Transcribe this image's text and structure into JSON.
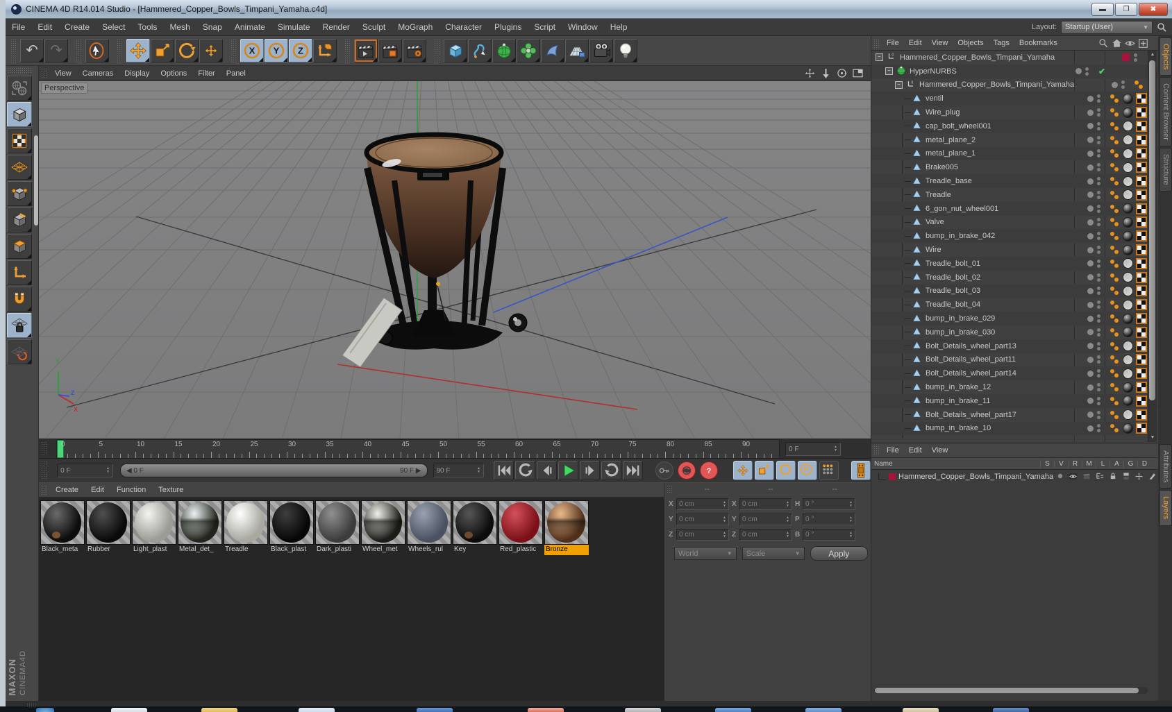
{
  "window": {
    "title": "CINEMA 4D R14.014 Studio - [Hammered_Copper_Bowls_Timpani_Yamaha.c4d]",
    "controls": {
      "minimize": "_",
      "restore": "r",
      "close": "X"
    }
  },
  "menu_bar": {
    "items": [
      "File",
      "Edit",
      "Create",
      "Select",
      "Tools",
      "Mesh",
      "Snap",
      "Animate",
      "Simulate",
      "Render",
      "Sculpt",
      "MoGraph",
      "Character",
      "Plugins",
      "Script",
      "Window",
      "Help"
    ],
    "layout_label": "Layout:",
    "layout_value": "Startup (User)"
  },
  "main_toolbar": {
    "groups": [
      [
        "undo-icon",
        "redo-icon"
      ],
      [
        "live-selection-icon"
      ],
      [
        "move-icon:active",
        "scale-icon",
        "rotate-icon",
        "last-tool-icon"
      ],
      [
        "axis-x-icon:active",
        "axis-y-icon:active",
        "axis-z-icon:active",
        "coordinate-system-icon"
      ],
      [
        "render-view-icon:ring",
        "render-picture-viewer-icon",
        "render-settings-icon"
      ],
      [
        "primitive-cube-icon",
        "spline-icon",
        "hypernurbs-icon",
        "mograph-icon",
        "deformer-icon",
        "floor-icon",
        "camera-icon",
        "light-icon"
      ]
    ],
    "axis_letters": {
      "axis-x-icon": "X",
      "axis-y-icon": "Y",
      "axis-z-icon": "Z"
    }
  },
  "left_toolbar": {
    "icons": [
      "make-editable-icon",
      "model-mode-icon:active",
      "texture-mode-icon",
      "workplane-mode-icon",
      "points-mode-icon",
      "edges-mode-icon",
      "polygons-mode-icon",
      "axis-mode-icon",
      "snap-icon",
      "lock-workplane-icon:active",
      "rotate-workplane-icon"
    ]
  },
  "branding": {
    "maxon": "MAXON",
    "cinema": "CINEMA4D"
  },
  "viewport": {
    "menus": [
      "View",
      "Cameras",
      "Display",
      "Options",
      "Filter",
      "Panel"
    ],
    "view_label": "Perspective",
    "nav_icons": [
      "pan-view-icon",
      "zoom-view-icon",
      "rotate-view-icon",
      "toggle-layout-icon"
    ],
    "axis_labels": {
      "x": "X",
      "y": "Y",
      "z": "Z"
    },
    "axis_colors": {
      "x": "#c03030",
      "y": "#2f9e3f",
      "z": "#3a55c8"
    }
  },
  "timeline": {
    "tick_step": 5,
    "tick_labels": [
      "0",
      "5",
      "10",
      "15",
      "20",
      "25",
      "30",
      "35",
      "40",
      "45",
      "50",
      "55",
      "60",
      "65",
      "70",
      "75",
      "80",
      "85",
      "90"
    ],
    "ruler_end_value": "0 F",
    "current_frame": "0 F",
    "range_start": "0 F",
    "range_end": "90 F",
    "end_frame": "90 F",
    "transport_icons": [
      "goto-start-icon",
      "play-backward-icon",
      "previous-frame-icon",
      "play-icon",
      "next-frame-icon",
      "play-cycle-icon",
      "goto-end-icon"
    ],
    "record_icons": [
      "record-key-icon",
      "autokey-icon",
      "keyframe-question-icon"
    ],
    "keying_icons": [
      "key-position-icon:active",
      "key-scale-icon:active",
      "key-rotation-icon:active",
      "key-parameter-icon:active",
      "key-pla-icon"
    ],
    "picture_viewer_icon": "picture-viewer-icon"
  },
  "materials": {
    "menus": [
      "Create",
      "Edit",
      "Function",
      "Texture"
    ],
    "items": [
      {
        "name": "Black_meta",
        "c1": "#6a6a6a",
        "c2": "#0d0d0d",
        "spot": "#7a5230"
      },
      {
        "name": "Rubber",
        "c1": "#505050",
        "c2": "#0a0a0a"
      },
      {
        "name": "Light_plast",
        "c1": "#f4f4f0",
        "c2": "#9c9c96"
      },
      {
        "name": "Metal_det_",
        "c1": "#eaf2f2",
        "c2": "#23251c",
        "chrome": true
      },
      {
        "name": "Treadle",
        "c1": "#ffffff",
        "c2": "#a8a8a0"
      },
      {
        "name": "Black_plast",
        "c1": "#3e3e3e",
        "c2": "#070707"
      },
      {
        "name": "Dark_plasti",
        "c1": "#909090",
        "c2": "#3c3c3c"
      },
      {
        "name": "Wheel_met",
        "c1": "#f0f0ea",
        "c2": "#1c1c18",
        "chrome": true
      },
      {
        "name": "Wheels_rul",
        "c1": "#9aa2b2",
        "c2": "#4a5160"
      },
      {
        "name": "Key",
        "c1": "#565656",
        "c2": "#0c0c0c",
        "spot": "#6e4a2a"
      },
      {
        "name": "Red_plastic",
        "c1": "#d4505a",
        "c2": "#7c1018"
      },
      {
        "name": "Bronze",
        "c1": "#eab88a",
        "c2": "#50301c",
        "chrome": true,
        "selected": true
      }
    ]
  },
  "coordinates": {
    "headers": [
      "--",
      "--",
      "--"
    ],
    "position": {
      "labels": [
        "X",
        "Y",
        "Z"
      ],
      "values": [
        "0 cm",
        "0 cm",
        "0 cm"
      ]
    },
    "scale": {
      "labels": [
        "X",
        "Y",
        "Z"
      ],
      "values": [
        "0 cm",
        "0 cm",
        "0 cm"
      ]
    },
    "rotation": {
      "labels": [
        "H",
        "P",
        "B"
      ],
      "values": [
        "0 °",
        "0 °",
        "0 °"
      ]
    },
    "mode1": "World",
    "mode2": "Scale",
    "apply_label": "Apply"
  },
  "object_manager": {
    "menus": [
      "File",
      "Edit",
      "View",
      "Objects",
      "Tags",
      "Bookmarks"
    ],
    "header_icons": [
      "search-icon",
      "home-icon",
      "eye-icon",
      "add-view-icon"
    ],
    "side_tabs": [
      {
        "label": "Objects",
        "active": true
      },
      {
        "label": "Content Browser",
        "active": false
      },
      {
        "label": "Structure",
        "active": false
      }
    ],
    "tree": [
      {
        "label": "Hammered_Copper_Bowls_Timpani_Yamaha",
        "depth": 0,
        "icon": "null-object-icon",
        "expander": true,
        "chip": "#a8133c"
      },
      {
        "label": "HyperNURBS",
        "depth": 1,
        "icon": "hypernurbs-small-icon",
        "expander": true,
        "dot": true,
        "check": true
      },
      {
        "label": "Hammered_Copper_Bowls_Timpani_Yamaha",
        "depth": 2,
        "icon": "null-object-icon",
        "expander": true,
        "dot": true,
        "phong": true
      },
      {
        "label": "ventil",
        "depth": 3,
        "icon": "polygon-icon",
        "dot": true,
        "phong": true,
        "mat": "#151515",
        "uvw": true
      },
      {
        "label": "Wire_plug",
        "depth": 3,
        "icon": "polygon-icon",
        "dot": true,
        "phong": true,
        "mat": "#151515",
        "uvw": true
      },
      {
        "label": "cap_bolt_wheel001",
        "depth": 3,
        "icon": "polygon-icon",
        "dot": true,
        "phong": true,
        "mat": "#d6d6d2",
        "uvw": true
      },
      {
        "label": "metal_plane_2",
        "depth": 3,
        "icon": "polygon-icon",
        "dot": true,
        "phong": true,
        "mat": "#d6d6d2",
        "uvw": true
      },
      {
        "label": "metal_plane_1",
        "depth": 3,
        "icon": "polygon-icon",
        "dot": true,
        "phong": true,
        "mat": "#d6d6d2",
        "uvw": true
      },
      {
        "label": "Brake005",
        "depth": 3,
        "icon": "polygon-icon",
        "dot": true,
        "phong": true,
        "mat": "#d6d6d2",
        "uvw": true
      },
      {
        "label": "Treadle_base",
        "depth": 3,
        "icon": "polygon-icon",
        "dot": true,
        "phong": true,
        "mat": "#d6d6d2",
        "uvw": true
      },
      {
        "label": "Treadle",
        "depth": 3,
        "icon": "polygon-icon",
        "dot": true,
        "phong": true,
        "mat": "#d6d6d2",
        "uvw": true
      },
      {
        "label": "6_gon_nut_wheel001",
        "depth": 3,
        "icon": "polygon-icon",
        "dot": true,
        "phong": true,
        "mat": "#151515",
        "uvw": true
      },
      {
        "label": "Valve",
        "depth": 3,
        "icon": "polygon-icon",
        "dot": true,
        "phong": true,
        "mat": "#151515",
        "uvw": true
      },
      {
        "label": "bump_in_brake_042",
        "depth": 3,
        "icon": "polygon-icon",
        "dot": true,
        "phong": true,
        "mat": "#151515",
        "uvw": true
      },
      {
        "label": "Wire",
        "depth": 3,
        "icon": "polygon-icon",
        "dot": true,
        "phong": true,
        "mat": "#151515",
        "uvw": true
      },
      {
        "label": "Treadle_bolt_01",
        "depth": 3,
        "icon": "polygon-icon",
        "dot": true,
        "phong": true,
        "mat": "#d6d6d2",
        "uvw": true
      },
      {
        "label": "Treadle_bolt_02",
        "depth": 3,
        "icon": "polygon-icon",
        "dot": true,
        "phong": true,
        "mat": "#d6d6d2",
        "uvw": true
      },
      {
        "label": "Treadle_bolt_03",
        "depth": 3,
        "icon": "polygon-icon",
        "dot": true,
        "phong": true,
        "mat": "#d6d6d2",
        "uvw": true
      },
      {
        "label": "Treadle_bolt_04",
        "depth": 3,
        "icon": "polygon-icon",
        "dot": true,
        "phong": true,
        "mat": "#d6d6d2",
        "uvw": true
      },
      {
        "label": "bump_in_brake_029",
        "depth": 3,
        "icon": "polygon-icon",
        "dot": true,
        "phong": true,
        "mat": "#151515",
        "uvw": true
      },
      {
        "label": "bump_in_brake_030",
        "depth": 3,
        "icon": "polygon-icon",
        "dot": true,
        "phong": true,
        "mat": "#151515",
        "uvw": true
      },
      {
        "label": "Bolt_Details_wheel_part13",
        "depth": 3,
        "icon": "polygon-icon",
        "dot": true,
        "phong": true,
        "mat": "#d6d6d2",
        "uvw": true
      },
      {
        "label": "Bolt_Details_wheel_part11",
        "depth": 3,
        "icon": "polygon-icon",
        "dot": true,
        "phong": true,
        "mat": "#d6d6d2",
        "uvw": true
      },
      {
        "label": "Bolt_Details_wheel_part14",
        "depth": 3,
        "icon": "polygon-icon",
        "dot": true,
        "phong": true,
        "mat": "#d6d6d2",
        "uvw": true
      },
      {
        "label": "bump_in_brake_12",
        "depth": 3,
        "icon": "polygon-icon",
        "dot": true,
        "phong": true,
        "mat": "#151515",
        "uvw": true
      },
      {
        "label": "bump_in_brake_11",
        "depth": 3,
        "icon": "polygon-icon",
        "dot": true,
        "phong": true,
        "mat": "#151515",
        "uvw": true
      },
      {
        "label": "Bolt_Details_wheel_part17",
        "depth": 3,
        "icon": "polygon-icon",
        "dot": true,
        "phong": true,
        "mat": "#d6d6d2",
        "uvw": true
      },
      {
        "label": "bump_in_brake_10",
        "depth": 3,
        "icon": "polygon-icon",
        "dot": true,
        "phong": true,
        "mat": "#151515",
        "uvw": true
      }
    ]
  },
  "layer_manager": {
    "menus": [
      "File",
      "Edit",
      "View"
    ],
    "name_header": "Name",
    "columns": [
      "S",
      "V",
      "R",
      "M",
      "L",
      "A",
      "G",
      "D"
    ],
    "rows": [
      {
        "name": "Hammered_Copper_Bowls_Timpani_Yamaha",
        "color": "#a8133c",
        "icons": [
          "solo-dot-icon",
          "visibility-eye-icon",
          "render-clap-icon",
          "manager-icon",
          "lock-icon",
          "animation-icon",
          "generators-icon",
          "deformers-icon"
        ]
      }
    ],
    "side_tabs": [
      {
        "label": "Attributes",
        "active": false
      },
      {
        "label": "Layers",
        "active": true
      }
    ]
  },
  "colors": {
    "accent_orange": "#e8911c",
    "selection_blue": "#9db3cc",
    "layer_red": "#a8133c",
    "hypernurbs_green": "#3fae49",
    "polygon_blue": "#a9cdec",
    "playhead_green": "#4ad87a"
  }
}
